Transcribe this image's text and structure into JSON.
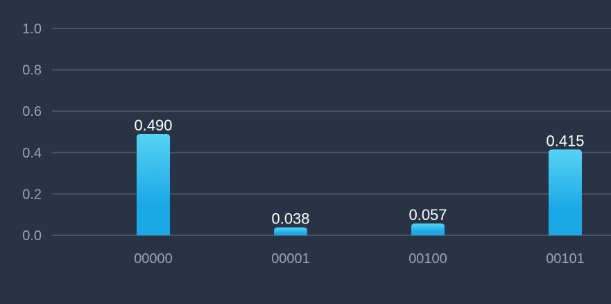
{
  "chart_data": {
    "type": "bar",
    "categories": [
      "00000",
      "00001",
      "00100",
      "00101"
    ],
    "values": [
      0.49,
      0.038,
      0.057,
      0.415
    ],
    "value_labels": [
      "0.490",
      "0.038",
      "0.057",
      "0.415"
    ],
    "title": "",
    "xlabel": "",
    "ylabel": "",
    "ylim": [
      0,
      1.0
    ],
    "yticks": [
      0.0,
      0.2,
      0.4,
      0.6,
      0.8,
      1.0
    ],
    "ytick_labels": [
      "0.0",
      "0.2",
      "0.4",
      "0.6",
      "0.8",
      "1.0"
    ],
    "grid": true,
    "legend": "none",
    "colors": {
      "background": "#283446",
      "grid": "#4a5668",
      "bar_top": "#55d3f3",
      "bar_bottom": "#1aa9e6",
      "tick_text": "#9aa6b8",
      "value_text": "#ffffff"
    }
  }
}
